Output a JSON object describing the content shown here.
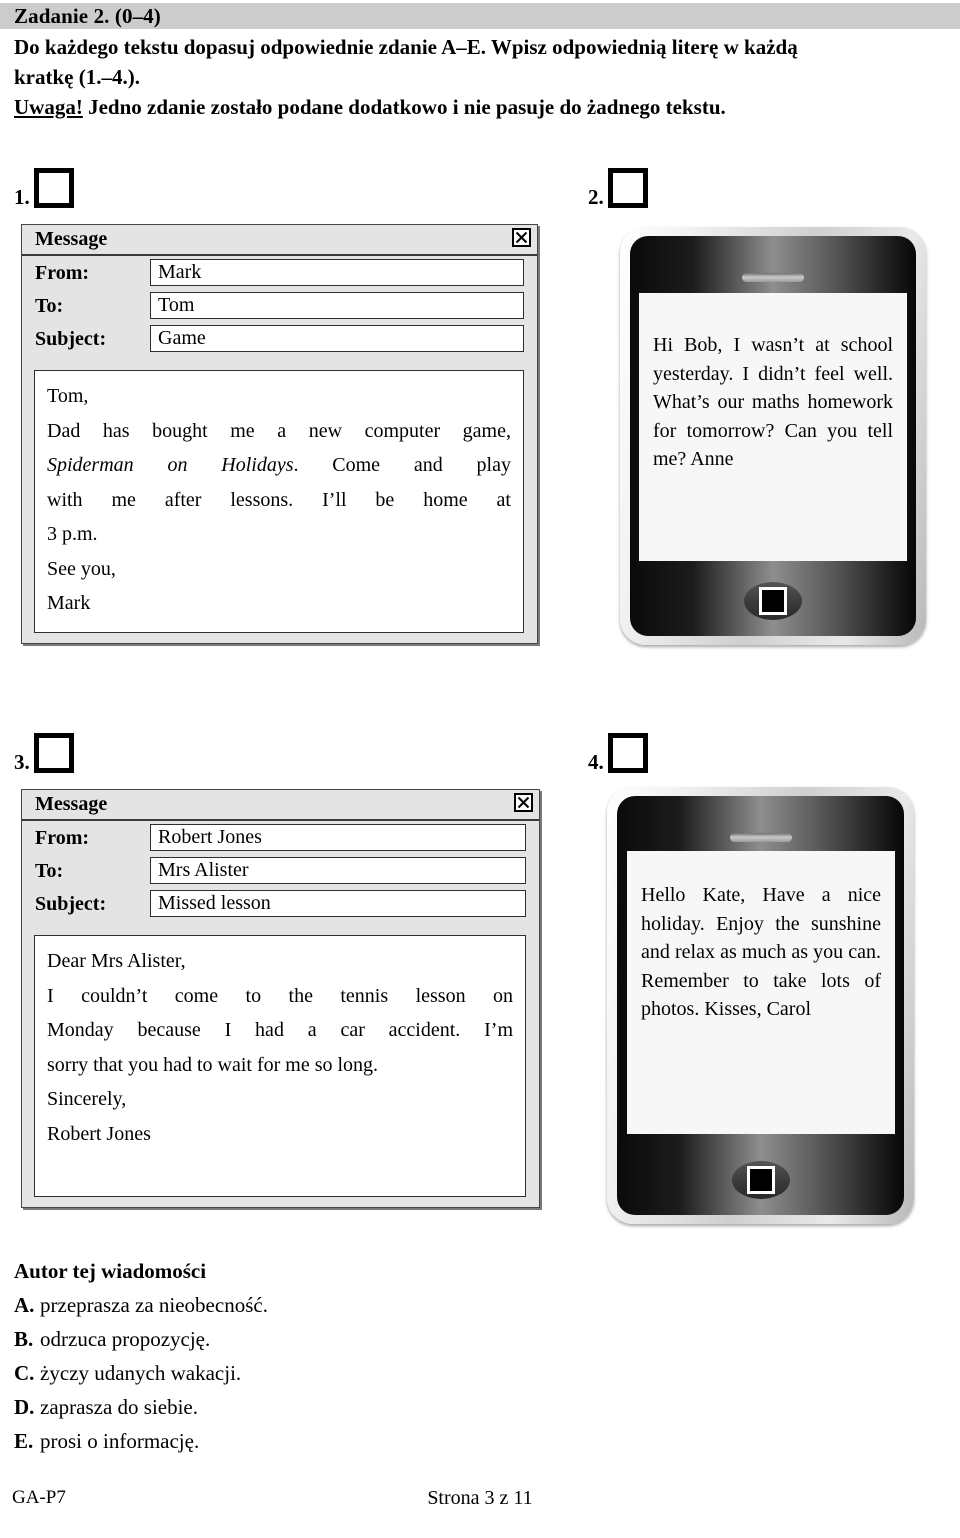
{
  "header": {
    "task_title": "Zadanie 2. (0–4)",
    "instruction_line1": "Do każdego tekstu dopasuj odpowiednie zdanie A–E. Wpisz odpowiednią literę w każdą",
    "instruction_line2": "kratkę (1.–4.).",
    "note_label": "Uwaga!",
    "note_text": " Jedno zdanie zostało podane dodatkowo i nie pasuje do żadnego tekstu."
  },
  "items": [
    {
      "number": "1.",
      "type": "email",
      "window_title": "Message",
      "close_icon": "close-icon",
      "fields": [
        {
          "label": "From:",
          "value": "Mark"
        },
        {
          "label": "To:",
          "value": "Tom"
        },
        {
          "label": "Subject:",
          "value": "Game"
        }
      ],
      "body_lines": [
        "Tom,",
        "Dad has bought me a new computer game,",
        "Spiderman on Holidays. Come and play",
        "with me after lessons. I’ll be home at",
        "3 p.m.",
        "See you,",
        "Mark"
      ]
    },
    {
      "number": "2.",
      "type": "phone",
      "body_lines": [
        "Hi Bob,",
        "I wasn’t at school",
        "yesterday. I didn’t feel",
        "well. What’s our",
        "maths homework for",
        "tomorrow? Can you tell",
        "me?",
        "Anne"
      ]
    },
    {
      "number": "3.",
      "type": "email",
      "window_title": "Message",
      "close_icon": "close-icon",
      "fields": [
        {
          "label": "From:",
          "value": "Robert Jones"
        },
        {
          "label": "To:",
          "value": "Mrs Alister"
        },
        {
          "label": "Subject:",
          "value": "Missed lesson"
        }
      ],
      "body_lines": [
        "Dear Mrs Alister,",
        "I couldn’t come to the tennis lesson on",
        "Monday because I had a car accident. I’m",
        "sorry that you had to wait for me so long.",
        "Sincerely,",
        "Robert Jones"
      ]
    },
    {
      "number": "4.",
      "type": "phone",
      "body_lines": [
        "Hello Kate,",
        "Have a nice holiday.",
        "Enjoy the sunshine and",
        "relax as much as you",
        "can. Remember to take",
        "lots of photos.",
        "Kisses,",
        "Carol"
      ]
    }
  ],
  "answers": {
    "heading": "Autor tej wiadomości",
    "options": [
      {
        "letter": "A.",
        "text": "przeprasza za nieobecność."
      },
      {
        "letter": "B.",
        "text": "odrzuca propozycję."
      },
      {
        "letter": "C.",
        "text": "życzy udanych wakacji."
      },
      {
        "letter": "D.",
        "text": "zaprasza do siebie."
      },
      {
        "letter": "E.",
        "text": "prosi o informację."
      }
    ]
  },
  "footer": {
    "code": "GA-P7",
    "page": "Strona 3 z 11"
  },
  "colors": {
    "band": "#cccccc",
    "window_bg": "#e4e4e4",
    "field_bg": "#ffffff",
    "screen_bg": "#f7f7f7",
    "ink": "#000000"
  }
}
